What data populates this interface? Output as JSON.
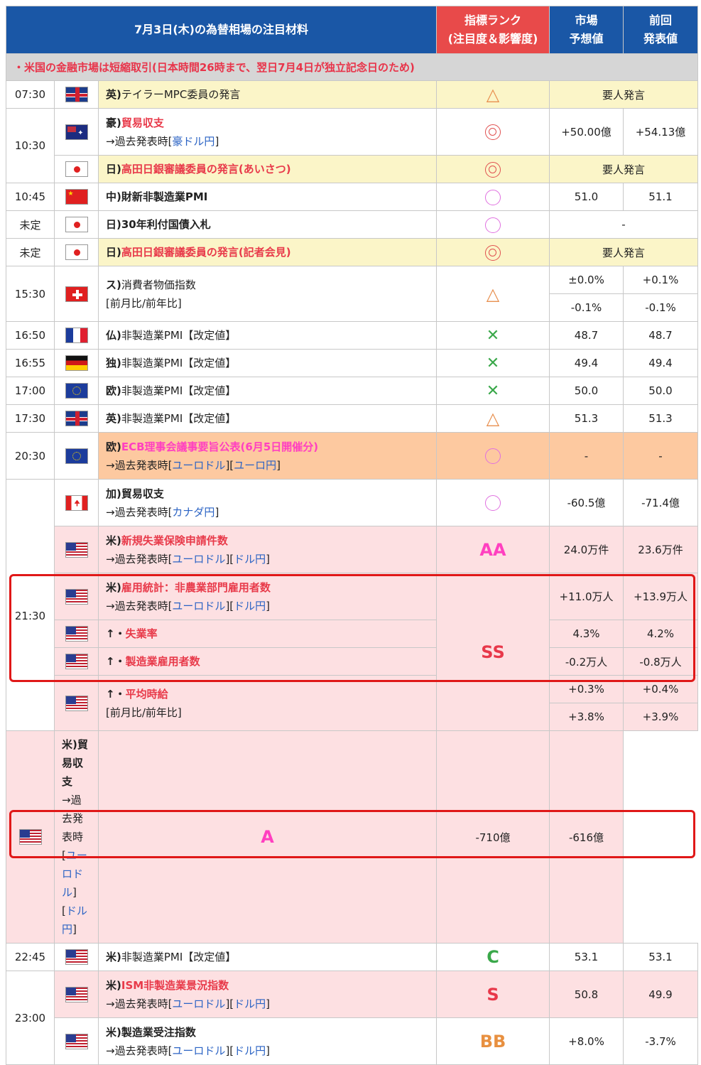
{
  "header": {
    "title": "7月3日(木)の為替相場の注目材料",
    "rank_title_1": "指標ランク",
    "rank_title_2": "(注目度＆影響度)",
    "forecast_1": "市場",
    "forecast_2": "予想値",
    "previous_1": "前回",
    "previous_2": "発表値"
  },
  "note": "・米国の金融市場は短縮取引(日本時間26時まで、翌日7月4日が独立記念日のため)",
  "rows": {
    "r1": {
      "time": "07:30",
      "flag": "uk-flag-icon",
      "country": "英)",
      "name": "テイラーMPC委員の発言",
      "rank": "△",
      "span_text": "要人発言"
    },
    "r2": {
      "time": "10:30",
      "country": "豪)",
      "name": "貿易収支",
      "sub": "→過去発表時[",
      "link1": "豪ドル円",
      "sub_end": "]",
      "rank": "◎",
      "forecast": "+50.00億",
      "previous": "+54.13億"
    },
    "r3": {
      "country": "日)",
      "name": "高田日銀審議委員の発言(あいさつ)",
      "rank": "◎",
      "span_text": "要人発言"
    },
    "r4": {
      "time": "10:45",
      "country": "中)",
      "name": "財新非製造業PMI",
      "rank": "○",
      "forecast": "51.0",
      "previous": "51.1"
    },
    "r5": {
      "time": "未定",
      "country": "日)",
      "name": "30年利付国債入札",
      "rank": "○",
      "span_text": "-"
    },
    "r6": {
      "time": "未定",
      "country": "日)",
      "name": "高田日銀審議委員の発言(記者会見)",
      "rank": "◎",
      "span_text": "要人発言"
    },
    "r7": {
      "time": "15:30",
      "country": "ス)",
      "name": "消費者物価指数",
      "sub": "[前月比/前年比]",
      "rank": "△",
      "forecast_a": "±0.0%",
      "previous_a": "+0.1%",
      "forecast_b": "-0.1%",
      "previous_b": "-0.1%"
    },
    "r8": {
      "time": "16:50",
      "country": "仏)",
      "name": "非製造業PMI【改定値】",
      "rank": "✕",
      "forecast": "48.7",
      "previous": "48.7"
    },
    "r9": {
      "time": "16:55",
      "country": "独)",
      "name": "非製造業PMI【改定値】",
      "rank": "✕",
      "forecast": "49.4",
      "previous": "49.4"
    },
    "r10": {
      "time": "17:00",
      "country": "欧)",
      "name": "非製造業PMI【改定値】",
      "rank": "✕",
      "forecast": "50.0",
      "previous": "50.0"
    },
    "r11": {
      "time": "17:30",
      "country": "英)",
      "name": "非製造業PMI【改定値】",
      "rank": "△",
      "forecast": "51.3",
      "previous": "51.3"
    },
    "r12": {
      "time": "20:30",
      "country": "欧)",
      "name": "ECB理事会議事要旨公表(6月5日開催分)",
      "sub": "→過去発表時[",
      "link1": "ユーロドル",
      "mid": "][",
      "link2": "ユーロ円",
      "sub_end": "]",
      "rank": "○",
      "forecast": "-",
      "previous": "-"
    },
    "r13": {
      "country": "加)",
      "name": "貿易収支",
      "sub": "→過去発表時[",
      "link1": "カナダ円",
      "sub_end": "]",
      "rank": "○",
      "forecast": "-60.5億",
      "previous": "-71.4億"
    },
    "r14": {
      "country": "米)",
      "name": "新規失業保険申請件数",
      "sub": "→過去発表時[",
      "link1": "ユーロドル",
      "mid": "][",
      "link2": "ドル円",
      "sub_end": "]",
      "rank": "AA",
      "forecast": "24.0万件",
      "previous": "23.6万件"
    },
    "r15": {
      "time": "21:30",
      "country": "米)",
      "name": "雇用統計：非農業部門雇用者数",
      "sub": "→過去発表時[",
      "link1": "ユーロドル",
      "mid": "][",
      "link2": "ドル円",
      "sub_end": "]",
      "rank": "SS",
      "forecast": "+11.0万人",
      "previous": "+13.9万人"
    },
    "r16": {
      "country": "↑・",
      "name": "失業率",
      "forecast": "4.3%",
      "previous": "4.2%"
    },
    "r17": {
      "country": "↑・",
      "name": "製造業雇用者数",
      "forecast": "-0.2万人",
      "previous": "-0.8万人"
    },
    "r18": {
      "country": "↑・",
      "name": "平均時給",
      "sub": "[前月比/前年比]",
      "forecast_a": "+0.3%",
      "previous_a": "+0.4%",
      "forecast_b": "+3.8%",
      "previous_b": "+3.9%"
    },
    "r19": {
      "country": "米)",
      "name": "貿易収支",
      "sub": "→過去発表時[",
      "link1": "ユーロドル",
      "mid": "][",
      "link2": "ドル円",
      "sub_end": "]",
      "rank": "A",
      "forecast": "-710億",
      "previous": "-616億"
    },
    "r20": {
      "time": "22:45",
      "country": "米)",
      "name": "非製造業PMI【改定値】",
      "rank": "C",
      "forecast": "53.1",
      "previous": "53.1"
    },
    "r21": {
      "time": "23:00",
      "country": "米)",
      "name": "ISM非製造業景況指数",
      "sub": "→過去発表時[",
      "link1": "ユーロドル",
      "mid": "][",
      "link2": "ドル円",
      "sub_end": "]",
      "rank": "S",
      "forecast": "50.8",
      "previous": "49.9"
    },
    "r22": {
      "country": "米)",
      "name": "製造業受注指数",
      "sub": "→過去発表時[",
      "link1": "ユーロドル",
      "mid": "][",
      "link2": "ドル円",
      "sub_end": "]",
      "rank": "BB",
      "forecast": "+8.0%",
      "previous": "-3.7%"
    }
  },
  "colors": {
    "header_blue": "#1a57a6",
    "header_red": "#e84a4a",
    "highlight": "#e01818"
  }
}
